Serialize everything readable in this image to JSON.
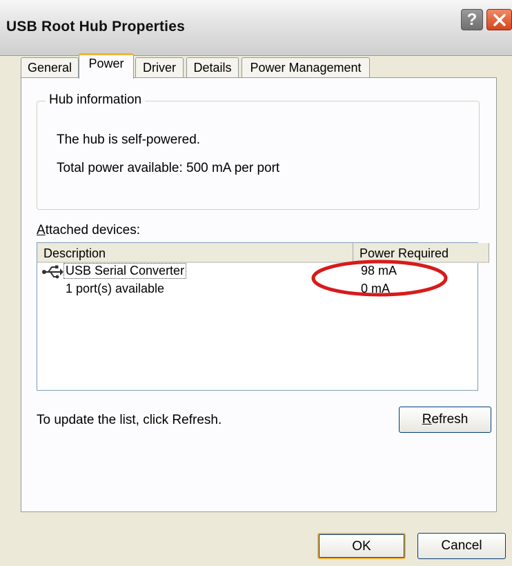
{
  "window": {
    "title": "USB Root Hub Properties",
    "help_glyph": "?",
    "annotation_color": "#d91a1a"
  },
  "tabs": [
    {
      "label": "General"
    },
    {
      "label": "Power"
    },
    {
      "label": "Driver"
    },
    {
      "label": "Details"
    },
    {
      "label": "Power Management"
    }
  ],
  "active_tab": "Power",
  "hub_info": {
    "legend": "Hub information",
    "self_powered_text": "The hub is self-powered.",
    "total_power_text": "Total power available:  500 mA per port"
  },
  "attached": {
    "label": "Attached devices:",
    "columns": [
      "Description",
      "Power Required"
    ],
    "rows": [
      {
        "description": "USB Serial Converter",
        "power": "98 mA",
        "icon": "usb-icon"
      },
      {
        "description": "1 port(s) available",
        "power": "0 mA"
      }
    ]
  },
  "refresh_hint": "To update the list, click Refresh.",
  "buttons": {
    "refresh": "Refresh",
    "ok": "OK",
    "cancel": "Cancel"
  }
}
